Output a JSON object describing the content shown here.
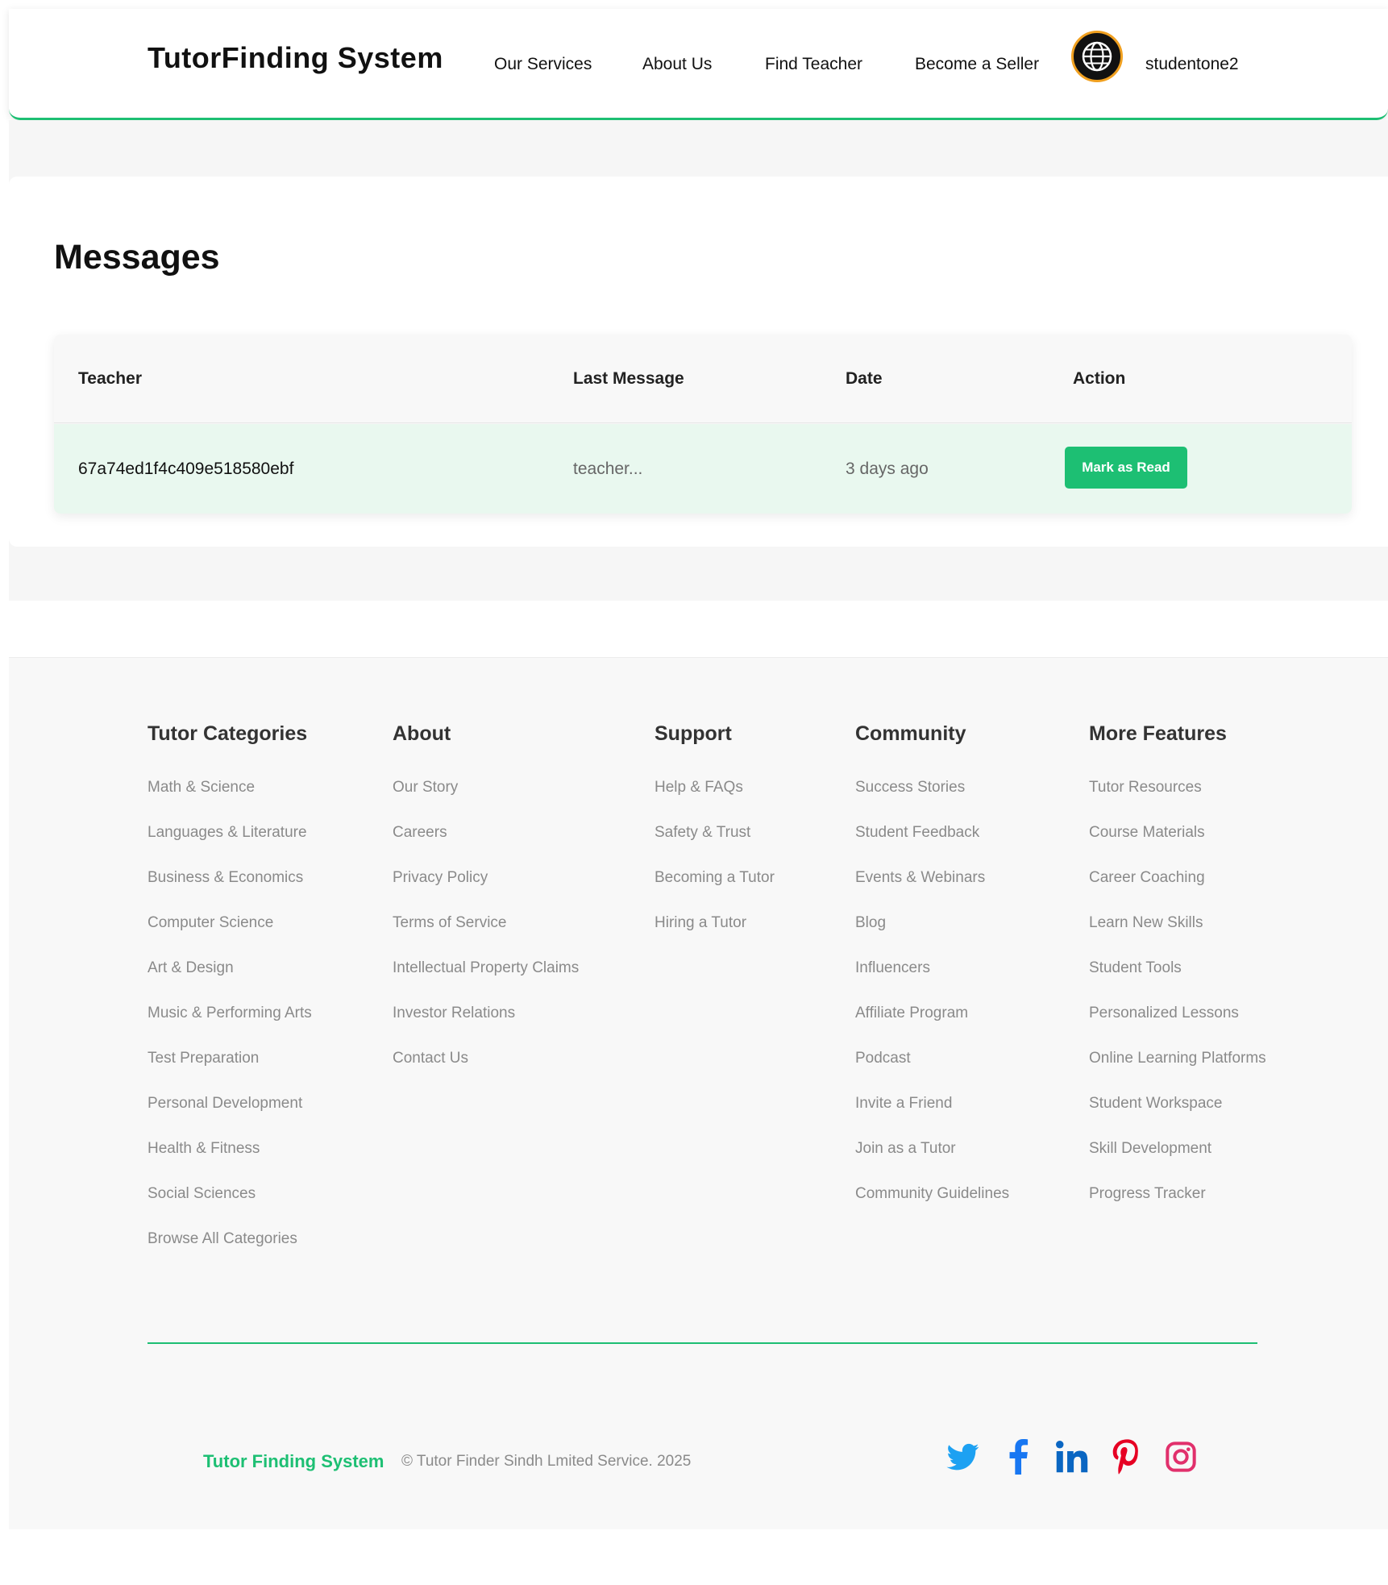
{
  "header": {
    "brand": "TutorFinding System",
    "nav": [
      "Our Services",
      "About Us",
      "Find Teacher",
      "Become a Seller"
    ],
    "username": "studentone2",
    "globe_icon": "globe-icon"
  },
  "messages": {
    "title": "Messages",
    "columns": [
      "Teacher",
      "Last Message",
      "Date",
      "Action"
    ],
    "rows": [
      {
        "teacher": "67a74ed1f4c409e518580ebf",
        "last_message": "teacher...",
        "date": "3 days ago",
        "action": "Mark as Read"
      }
    ]
  },
  "footer": {
    "columns": [
      {
        "title": "Tutor Categories",
        "links": [
          "Math & Science",
          "Languages & Literature",
          "Business & Economics",
          "Computer Science",
          "Art & Design",
          "Music & Performing Arts",
          "Test Preparation",
          "Personal Development",
          "Health & Fitness",
          "Social Sciences",
          "Browse All Categories"
        ]
      },
      {
        "title": "About",
        "links": [
          "Our Story",
          "Careers",
          "Privacy Policy",
          "Terms of Service",
          "Intellectual Property Claims",
          "Investor Relations",
          "Contact Us"
        ]
      },
      {
        "title": "Support",
        "links": [
          "Help & FAQs",
          "Safety & Trust",
          "Becoming a Tutor",
          "Hiring a Tutor"
        ]
      },
      {
        "title": "Community",
        "links": [
          "Success Stories",
          "Student Feedback",
          "Events & Webinars",
          "Blog",
          "Influencers",
          "Affiliate Program",
          "Podcast",
          "Invite a Friend",
          "Join as a Tutor",
          "Community Guidelines"
        ]
      },
      {
        "title": "More Features",
        "links": [
          "Tutor Resources",
          "Course Materials",
          "Career Coaching",
          "Learn New Skills",
          "Student Tools",
          "Personalized Lessons",
          "Online Learning Platforms",
          "Student Workspace",
          "Skill Development",
          "Progress Tracker"
        ]
      }
    ],
    "brand": "Tutor Finding System",
    "copyright": "© Tutor Finder Sindh Lmited Service. 2025",
    "social_icons": [
      "twitter-icon",
      "facebook-icon",
      "linkedin-icon",
      "pinterest-icon",
      "instagram-icon"
    ]
  },
  "colors": {
    "accent": "#1dbf73",
    "row_highlight": "#e9f8ef",
    "twitter": "#1da1f2",
    "facebook": "#1877f2",
    "linkedin": "#0a66c2",
    "pinterest": "#e60023",
    "instagram": "#e1306c"
  }
}
